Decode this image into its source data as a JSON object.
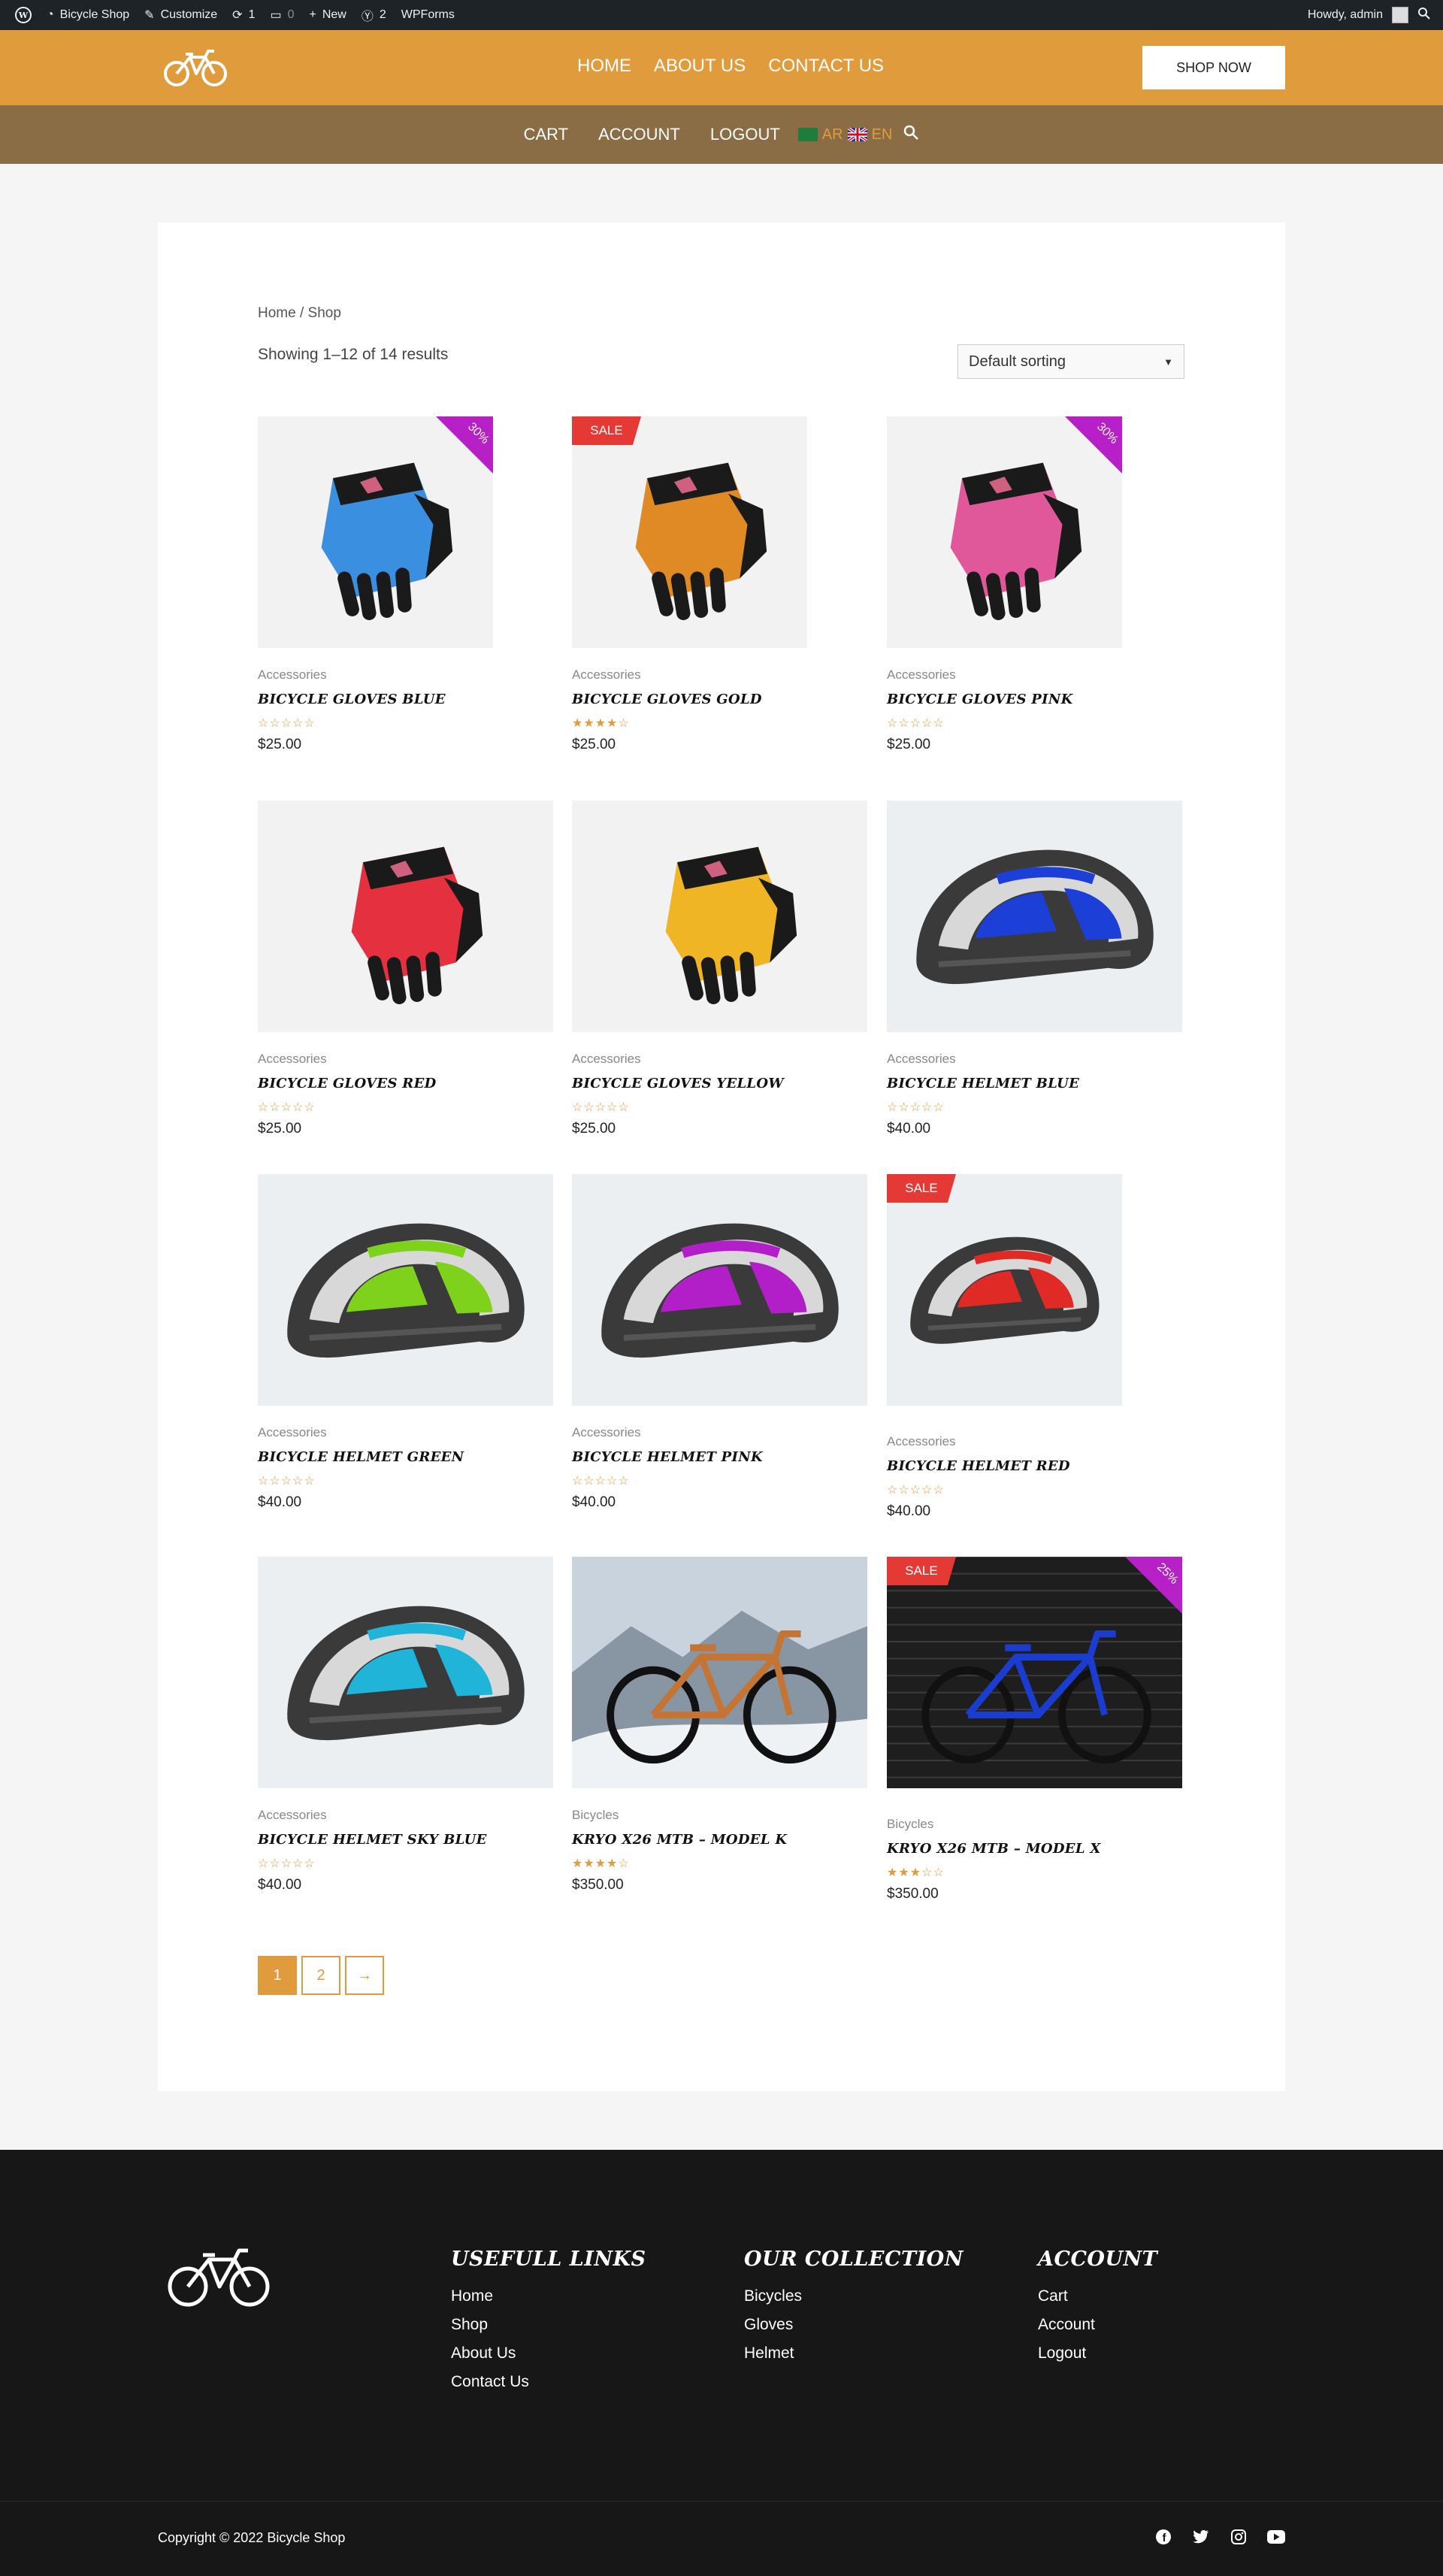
{
  "adminbar": {
    "site": "Bicycle Shop",
    "customize": "Customize",
    "updates": "1",
    "comments": "0",
    "new": "New",
    "yoast": "2",
    "wpforms": "WPForms",
    "howdy": "Howdy, admin"
  },
  "header": {
    "nav": [
      "HOME",
      "ABOUT US",
      "CONTACT US"
    ],
    "shop_now": "SHOP NOW"
  },
  "subnav": {
    "items": [
      "CART",
      "ACCOUNT",
      "LOGOUT"
    ],
    "lang_ar": "AR",
    "lang_en": "EN"
  },
  "shop": {
    "breadcrumb": "Home / Shop",
    "result_count": "Showing 1–12 of 14 results",
    "sorting": "Default sorting",
    "sale_label": "SALE",
    "products": [
      {
        "category": "Accessories",
        "title": "BICYCLE GLOVES BLUE",
        "price": "$25.00",
        "rating": 0,
        "badge": "pct",
        "badge_text": "30%",
        "color": "#3a8fe0"
      },
      {
        "category": "Accessories",
        "title": "BICYCLE GLOVES GOLD",
        "price": "$25.00",
        "rating": 4,
        "badge": "sale",
        "color": "#e08a25"
      },
      {
        "category": "Accessories",
        "title": "BICYCLE GLOVES PINK",
        "price": "$25.00",
        "rating": 0,
        "badge": "pct",
        "badge_text": "30%",
        "color": "#e0589a"
      },
      {
        "category": "Accessories",
        "title": "BICYCLE GLOVES RED",
        "price": "$25.00",
        "rating": 0,
        "badge": "",
        "color": "#e53040"
      },
      {
        "category": "Accessories",
        "title": "BICYCLE GLOVES YELLOW",
        "price": "$25.00",
        "rating": 0,
        "badge": "",
        "color": "#f0b524"
      },
      {
        "category": "Accessories",
        "title": "BICYCLE HELMET BLUE",
        "price": "$40.00",
        "rating": 0,
        "badge": "",
        "color": "#1c3fd8"
      },
      {
        "category": "Accessories",
        "title": "BICYCLE HELMET GREEN",
        "price": "$40.00",
        "rating": 0,
        "badge": "",
        "color": "#7ed21c"
      },
      {
        "category": "Accessories",
        "title": "BICYCLE HELMET PINK",
        "price": "$40.00",
        "rating": 0,
        "badge": "",
        "color": "#b21fc8"
      },
      {
        "category": "Accessories",
        "title": "BICYCLE HELMET RED",
        "price": "$40.00",
        "rating": 0,
        "badge": "sale",
        "color": "#e02a25"
      },
      {
        "category": "Accessories",
        "title": "BICYCLE HELMET SKY BLUE",
        "price": "$40.00",
        "rating": 0,
        "badge": "",
        "color": "#1fb4d8"
      },
      {
        "category": "Bicycles",
        "title": "KRYO X26 MTB – MODEL K",
        "price": "$350.00",
        "rating": 4,
        "badge": "",
        "color": "#c47535"
      },
      {
        "category": "Bicycles",
        "title": "KRYO X26 MTB – MODEL X",
        "price": "$350.00",
        "rating": 3,
        "badge": "sale",
        "badge2": "pct",
        "badge_text": "25%",
        "color": "#1a3dcf"
      }
    ],
    "pages": [
      "1",
      "2",
      "→"
    ]
  },
  "footer": {
    "col1": {
      "title": "USEFULL LINKS",
      "links": [
        "Home",
        "Shop",
        "About Us",
        "Contact Us"
      ]
    },
    "col2": {
      "title": "OUR COLLECTION",
      "links": [
        "Bicycles",
        "Gloves",
        "Helmet"
      ]
    },
    "col3": {
      "title": "ACCOUNT",
      "links": [
        "Cart",
        "Account",
        "Logout"
      ]
    },
    "copyright": "Copyright © 2022 Bicycle Shop",
    "social": [
      "facebook-icon",
      "twitter-icon",
      "instagram-icon",
      "youtube-icon"
    ]
  },
  "colors": {
    "accent": "#e09b3d",
    "subnav": "#8a6c45",
    "sale": "#e53935",
    "percent_badge": "#b71fc7",
    "footer": "#171718"
  }
}
